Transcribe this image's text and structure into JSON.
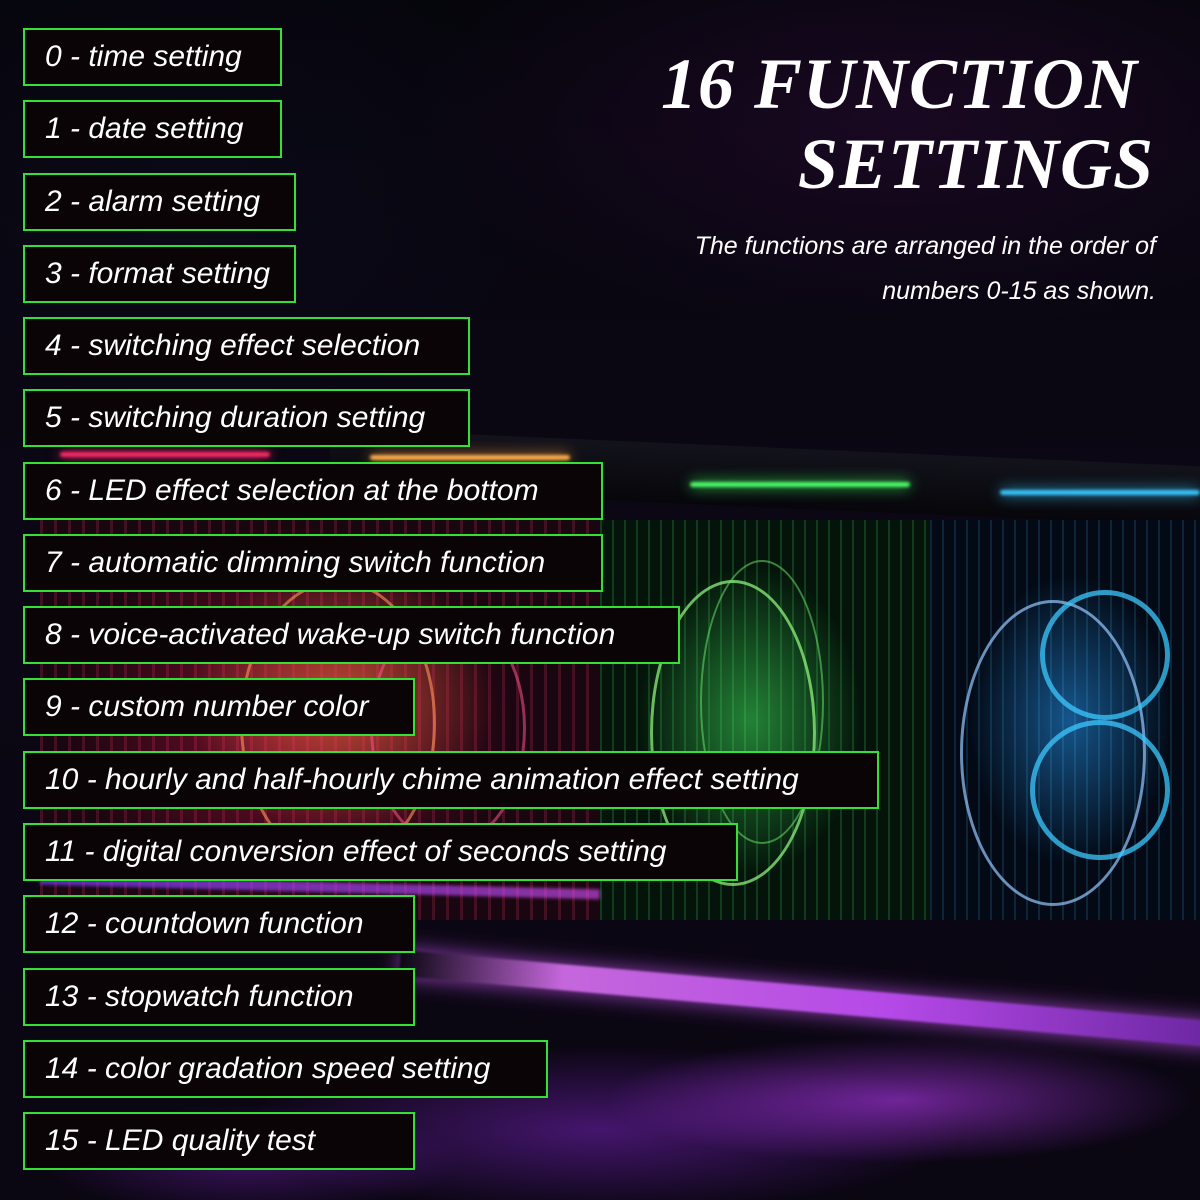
{
  "heading": {
    "line1": "16 FUNCTION",
    "line2": "SETTINGS"
  },
  "subtitle": {
    "line1": "The functions are arranged in the order of",
    "line2": "numbers 0-15 as shown."
  },
  "colors": {
    "box_border": "#35e035",
    "box_fill": "#0b0406",
    "text": "#ffffff",
    "background": "#07050d"
  },
  "functions": [
    {
      "number": 0,
      "label": "0 - time setting"
    },
    {
      "number": 1,
      "label": "1 - date setting"
    },
    {
      "number": 2,
      "label": "2 - alarm setting"
    },
    {
      "number": 3,
      "label": "3 - format setting"
    },
    {
      "number": 4,
      "label": "4 - switching effect selection"
    },
    {
      "number": 5,
      "label": "5 - switching duration setting"
    },
    {
      "number": 6,
      "label": "6 - LED effect selection at the bottom"
    },
    {
      "number": 7,
      "label": "7 - automatic dimming switch function"
    },
    {
      "number": 8,
      "label": "8 - voice-activated wake-up switch function"
    },
    {
      "number": 9,
      "label": "9 - custom number color"
    },
    {
      "number": 10,
      "label": "10 - hourly and half-hourly chime animation effect setting"
    },
    {
      "number": 11,
      "label": "11 - digital conversion effect of seconds setting"
    },
    {
      "number": 12,
      "label": "12 - countdown function"
    },
    {
      "number": 13,
      "label": "13 - stopwatch function"
    },
    {
      "number": 14,
      "label": "14 - color gradation speed setting"
    },
    {
      "number": 15,
      "label": "15 - LED quality test"
    }
  ],
  "background_photo": {
    "subject": "acrylic LED nixie-style clock",
    "visible_digit_colors": [
      "red-pink",
      "green",
      "cyan-blue"
    ],
    "base_light_color": "purple"
  }
}
